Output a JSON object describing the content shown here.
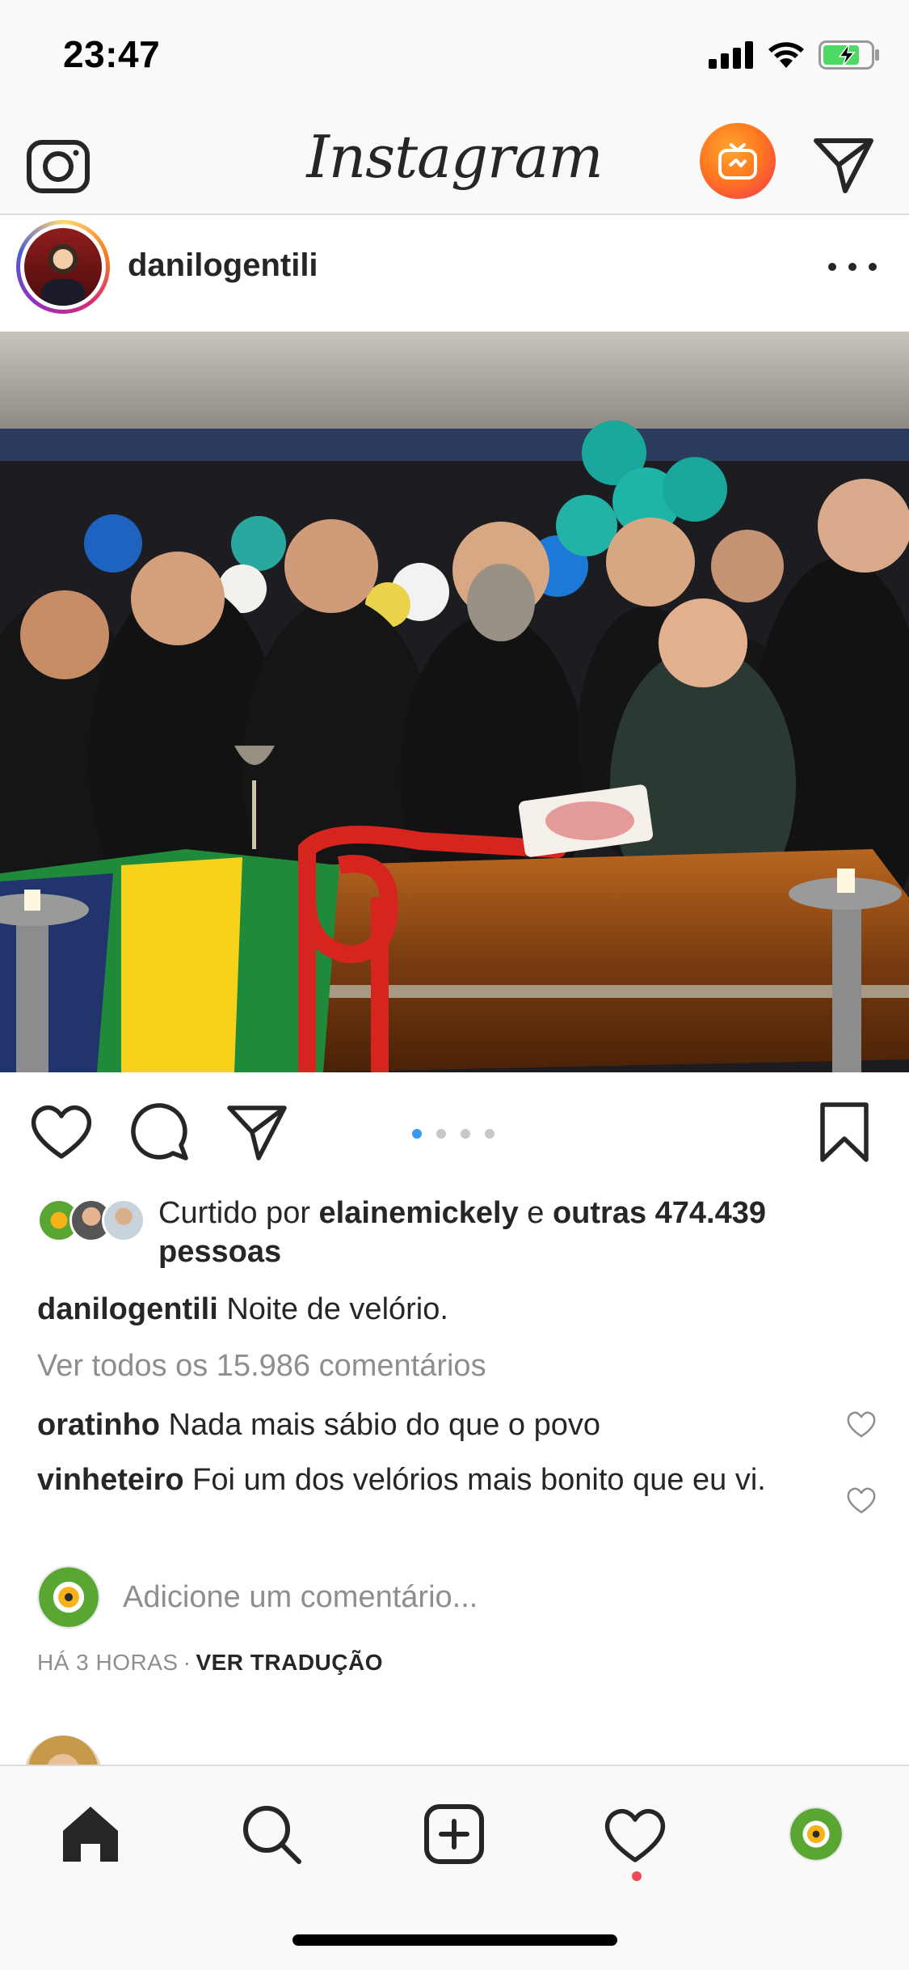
{
  "status_bar": {
    "time": "23:47",
    "icons": [
      "cellular-signal-icon",
      "wifi-icon",
      "battery-charging-icon"
    ]
  },
  "top_nav": {
    "logo": "Instagram",
    "left_icon": "camera-icon",
    "right_icons": [
      "igtv-icon",
      "direct-message-icon"
    ],
    "igtv_gradient": [
      "#ffa530",
      "#f2304f"
    ]
  },
  "post": {
    "username": "danilogentili",
    "photo_description_icon": "photo",
    "carousel": {
      "count": 4,
      "active_index": 0,
      "active_color": "#3897f0"
    },
    "likes": {
      "prefix": "Curtido por ",
      "first_liker": "elainemickely",
      "joiner": " e ",
      "others": "outras 474.439",
      "suffix": "pessoas"
    },
    "caption": {
      "username": "danilogentili",
      "text": "Noite de velório."
    },
    "view_comments": "Ver todos os 15.986 comentários",
    "comments": [
      {
        "username": "oratinho",
        "text": "Nada mais sábio do que o povo"
      },
      {
        "username": "vinheteiro",
        "text": "Foi um dos velórios mais bonito que eu vi."
      }
    ],
    "add_comment_placeholder": "Adicione um comentário...",
    "timestamp": "HÁ 3 HORAS",
    "separator": "·",
    "translate_label": "VER TRADUÇÃO"
  },
  "tab_bar": {
    "items": [
      "home-icon",
      "search-icon",
      "new-post-icon",
      "activity-heart-icon",
      "profile-avatar"
    ],
    "notification_color": "#ed4956"
  },
  "colors": {
    "text": "#262626",
    "secondary_text": "#8e8e8e",
    "divider": "#dbdbdb",
    "background": "#ffffff",
    "bars": "#f9f9f9"
  }
}
